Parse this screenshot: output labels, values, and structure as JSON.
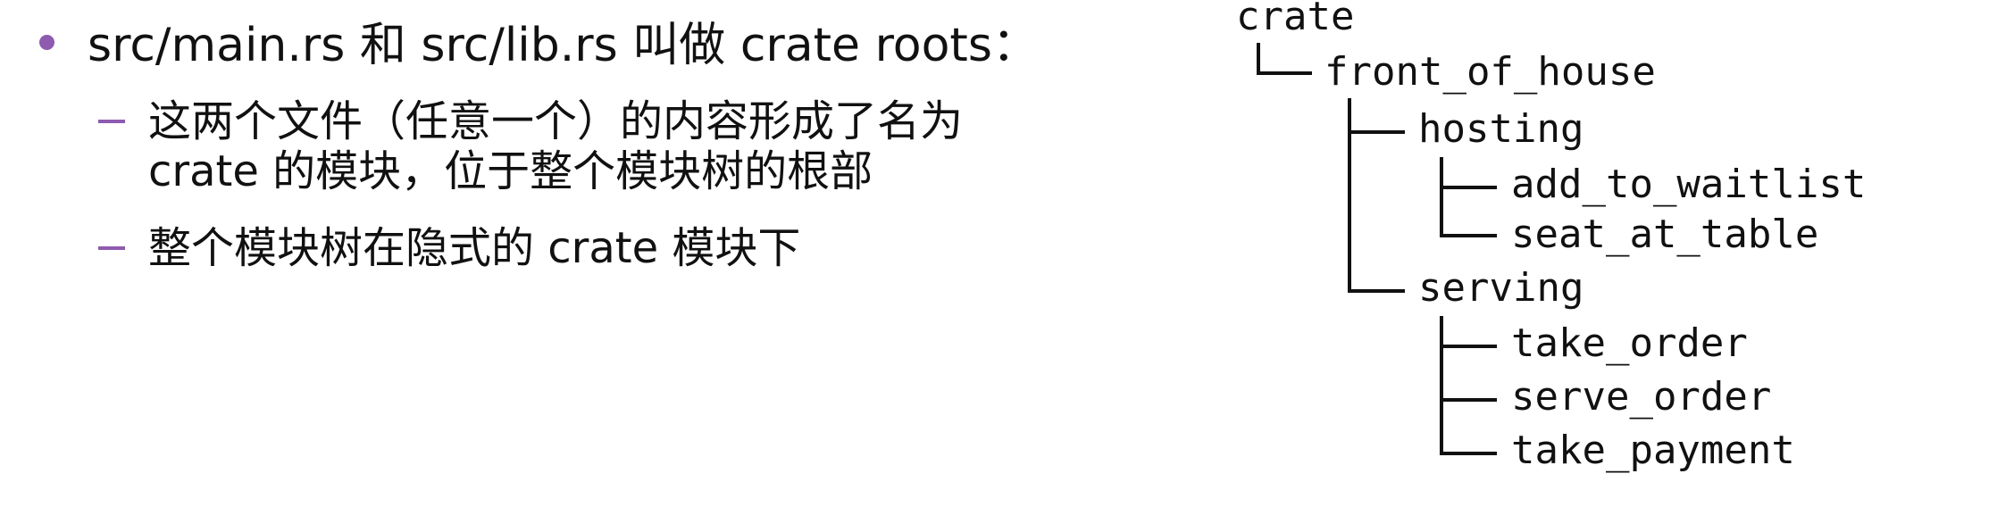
{
  "colors": {
    "bullet_dot": "#8e5bb0",
    "dash": "#8e5bb0",
    "text": "#111111"
  },
  "bullets": {
    "main": {
      "text": "src/main.rs 和 src/lib.rs 叫做 crate roots："
    },
    "sub": [
      {
        "line1": "这两个文件（任意一个）的内容形成了名为",
        "line2": "crate 的模块，位于整个模块树的根部"
      },
      {
        "line1": "整个模块树在隐式的 crate 模块下"
      }
    ]
  },
  "tree": {
    "root": "crate",
    "level1": "front_of_house",
    "hosting": "hosting",
    "add_to_waitlist": "add_to_waitlist",
    "seat_at_table": "seat_at_table",
    "serving": "serving",
    "take_order": "take_order",
    "serve_order": "serve_order",
    "take_payment": "take_payment"
  }
}
